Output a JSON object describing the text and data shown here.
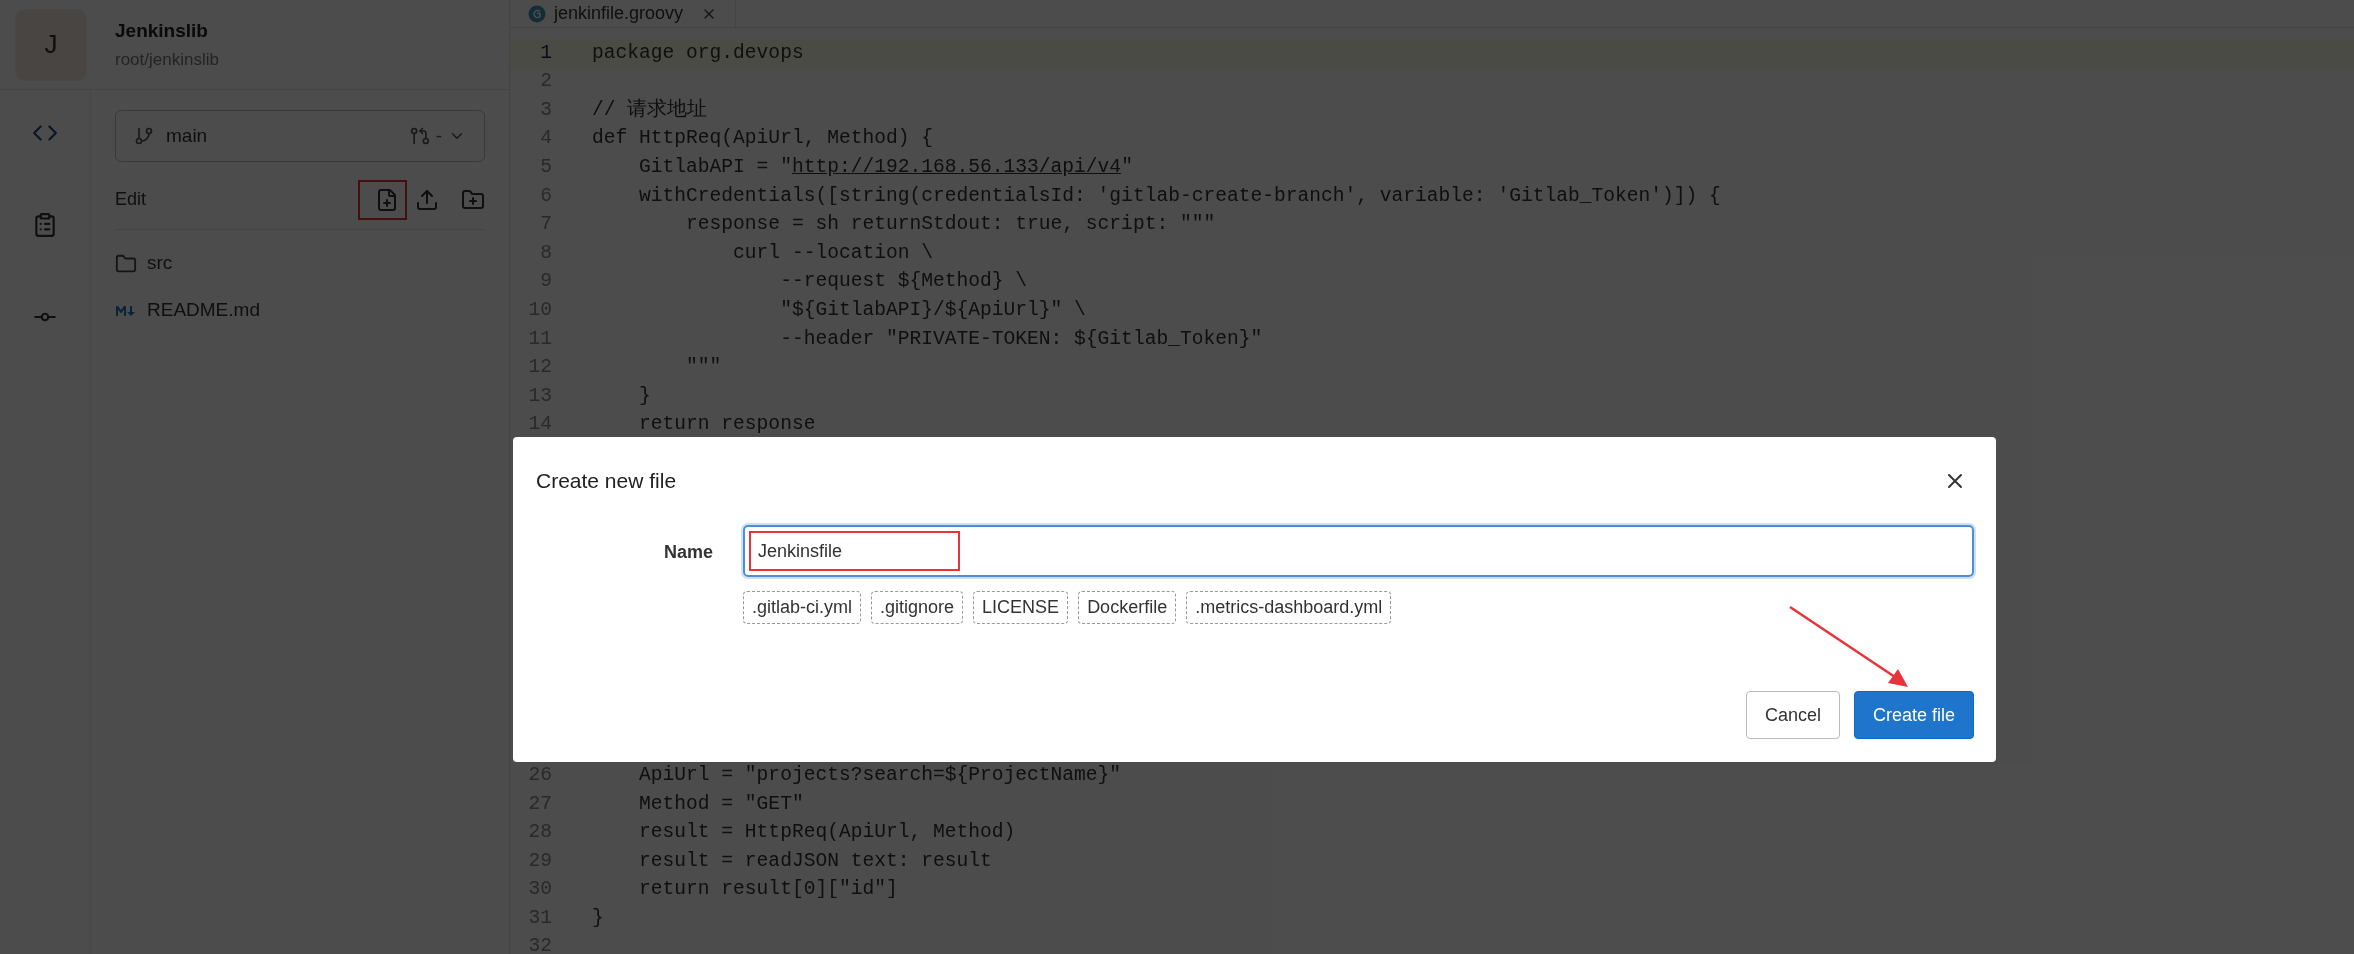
{
  "project": {
    "initial": "J",
    "name": "Jenkinslib",
    "path": "root/jenkinslib"
  },
  "branch": {
    "name": "main",
    "merge_request": "-"
  },
  "edit_label": "Edit",
  "files": [
    {
      "kind": "folder",
      "name": "src"
    },
    {
      "kind": "markdown",
      "name": "README.md"
    }
  ],
  "editor_tab": {
    "title": "jenkinfile.groovy"
  },
  "code_top": [
    {
      "number": "1",
      "text": "package org.devops",
      "current": true
    },
    {
      "number": "2",
      "current": false
    },
    {
      "number": "3",
      "text": "// 请求地址",
      "current": false
    },
    {
      "number": "4",
      "text": "def HttpReq(ApiUrl, Method) {",
      "current": false
    },
    {
      "number": "5",
      "text_before": "    GitlabAPI = \"",
      "link": "http://192.168.56.133/api/v4",
      "text_after": "\"",
      "current": false
    },
    {
      "number": "6",
      "text": "    withCredentials([string(credentialsId: 'gitlab-create-branch', variable: 'Gitlab_Token')]) {",
      "current": false
    },
    {
      "number": "7",
      "text": "        response = sh returnStdout: true, script: \"\"\"",
      "current": false
    },
    {
      "number": "8",
      "text": "            curl --location \\",
      "current": false
    },
    {
      "number": "9",
      "text": "                --request ${Method} \\",
      "current": false
    },
    {
      "number": "10",
      "text": "                \"${GitlabAPI}/${ApiUrl}\" \\",
      "current": false
    },
    {
      "number": "11",
      "text": "                --header \"PRIVATE-TOKEN: ${Gitlab_Token}\"",
      "current": false
    },
    {
      "number": "12",
      "text": "        \"\"\"",
      "current": false
    },
    {
      "number": "13",
      "text": "    }",
      "current": false
    },
    {
      "number": "14",
      "text": "    return response",
      "current": false
    }
  ],
  "code_bottom": [
    {
      "number": "26",
      "text": "    ApiUrl = \"projects?search=${ProjectName}\"",
      "current": false
    },
    {
      "number": "27",
      "text": "    Method = \"GET\"",
      "current": false
    },
    {
      "number": "28",
      "text": "    result = HttpReq(ApiUrl, Method)",
      "current": false
    },
    {
      "number": "29",
      "text": "    result = readJSON text: result",
      "current": false
    },
    {
      "number": "30",
      "text": "    return result[0][\"id\"]",
      "current": false
    },
    {
      "number": "31",
      "text": "}",
      "current": false
    },
    {
      "number": "32",
      "current": false
    }
  ],
  "dialog": {
    "title": "Create new file",
    "name_label": "Name",
    "name_value": "Jenkinsfile",
    "templates": [
      ".gitlab-ci.yml",
      ".gitignore",
      "LICENSE",
      "Dockerfile",
      ".metrics-dashboard.yml"
    ],
    "buttons": [
      {
        "kind": "secondary",
        "label": "Cancel"
      },
      {
        "kind": "primary",
        "label": "Create file"
      }
    ]
  }
}
